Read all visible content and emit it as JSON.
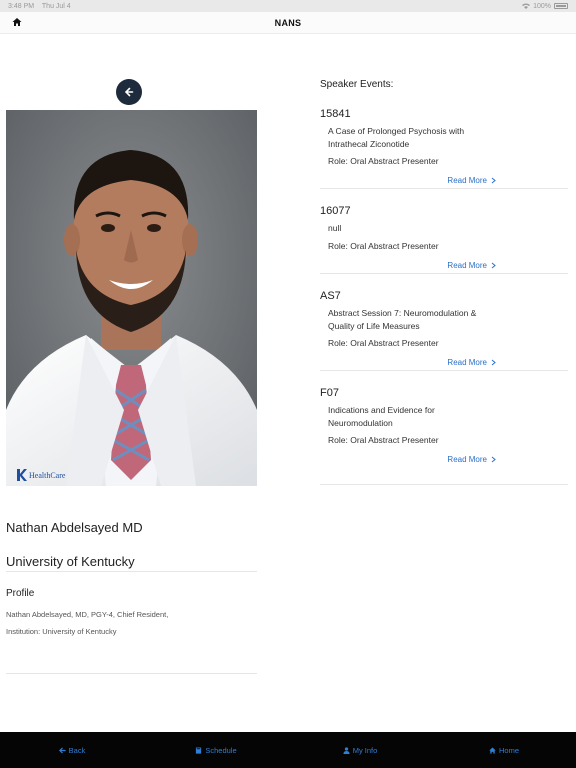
{
  "status_bar": {
    "time": "3:48 PM",
    "date": "Thu Jul 4",
    "battery": "100%"
  },
  "nav": {
    "title": "NANS"
  },
  "speaker": {
    "name": "Nathan Abdelsayed MD",
    "institution": "University of Kentucky",
    "profile_label": "Profile",
    "profile_lines": [
      "Nathan Abdelsayed, MD, PGY-4, Chief Resident,",
      "Institution: University of Kentucky"
    ],
    "photo_badge": "HealthCare"
  },
  "events": {
    "title": "Speaker Events:",
    "read_more": "Read More",
    "items": [
      {
        "code": "15841",
        "title": "A Case of Prolonged Psychosis with Intrathecal Ziconotide",
        "role": "Role: Oral Abstract Presenter"
      },
      {
        "code": "16077",
        "title": "null",
        "role": "Role: Oral Abstract Presenter"
      },
      {
        "code": "AS7",
        "title": "Abstract Session 7: Neuromodulation & Quality of Life Measures",
        "role": "Role: Oral Abstract Presenter"
      },
      {
        "code": "F07",
        "title": "Indications and Evidence for Neuromodulation",
        "role": "Role: Oral Abstract Presenter"
      }
    ]
  },
  "tabs": [
    {
      "label": "Back",
      "icon": "arrow-left-icon"
    },
    {
      "label": "Schedule",
      "icon": "book-icon"
    },
    {
      "label": "My Info",
      "icon": "user-icon"
    },
    {
      "label": "Home",
      "icon": "home-icon"
    }
  ],
  "colors": {
    "accent": "#2f7fd6",
    "tab_bar_bg": "#050505",
    "back_button_bg": "#1e2b3c"
  }
}
